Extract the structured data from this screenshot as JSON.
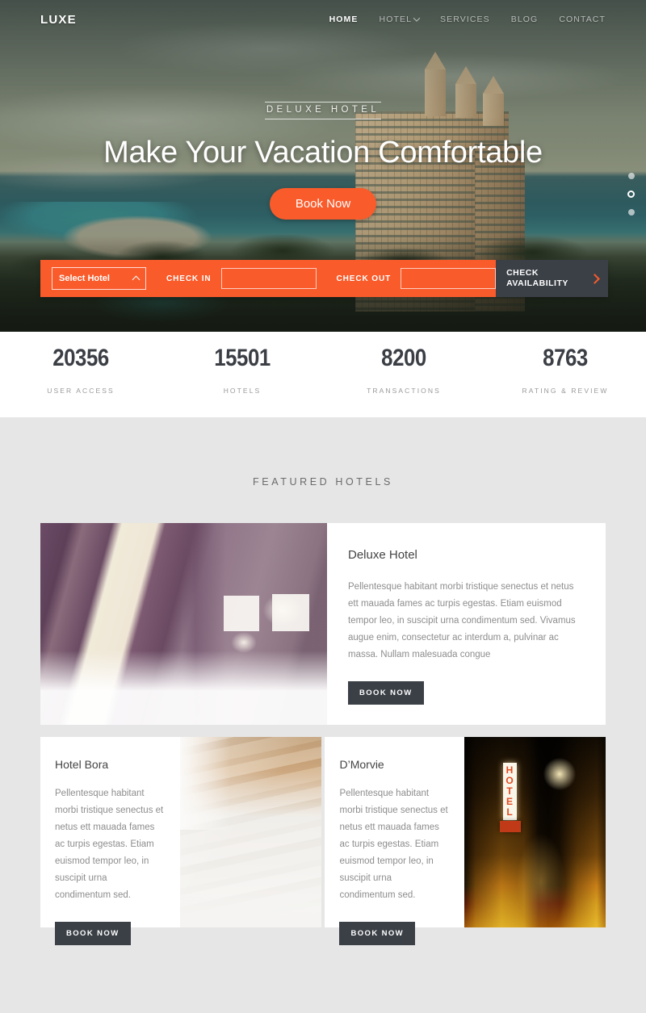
{
  "nav": {
    "brand": "LUXE",
    "links": [
      {
        "label": "HOME",
        "active": true
      },
      {
        "label": "HOTEL",
        "active": false,
        "has_caret": true
      },
      {
        "label": "SERVICES",
        "active": false
      },
      {
        "label": "BLOG",
        "active": false
      },
      {
        "label": "CONTACT",
        "active": false
      }
    ]
  },
  "hero": {
    "eyebrow": "DELUXE HOTEL",
    "title": "Make Your Vacation Comfortable",
    "cta_label": "Book Now",
    "accent_color": "#f95b2b",
    "slider": {
      "total": 3,
      "active_index": 1
    }
  },
  "booking": {
    "select_value": "Select Hotel",
    "checkin_label": "CHECK IN",
    "checkin_value": "",
    "checkin_placeholder": "",
    "checkout_label": "CHECK OUT",
    "checkout_value": "",
    "checkout_placeholder": "",
    "submit_line1": "CHECK",
    "submit_line2": "AVAILABILITY",
    "bar_color": "#f95b2b",
    "submit_color": "#3b4047"
  },
  "stats": [
    {
      "value": "20356",
      "label": "USER ACCESS"
    },
    {
      "value": "15501",
      "label": "HOTELS"
    },
    {
      "value": "8200",
      "label": "TRANSACTIONS"
    },
    {
      "value": "8763",
      "label": "RATING & REVIEW"
    }
  ],
  "featured": {
    "heading": "FEATURED HOTELS",
    "cards": [
      {
        "title": "Deluxe Hotel",
        "text": "Pellentesque habitant morbi tristique senectus et netus ett mauada fames ac turpis egestas. Etiam euismod tempor leo, in suscipit urna condimentum sed. Vivamus augue enim, consectetur ac interdum a, pulvinar ac massa. Nullam malesuada congue",
        "button": "BOOK NOW",
        "image": "hotel-bedroom-photo"
      },
      {
        "title": "Hotel Bora",
        "text": "Pellentesque habitant morbi tristique senectus et netus ett mauada fames ac turpis egestas. Etiam euismod tempor leo, in suscipit urna condimentum sed.",
        "button": "BOOK NOW",
        "image": "bed-pillows-photo"
      },
      {
        "title": "D’Morvie",
        "text": "Pellentesque habitant morbi tristique senectus et netus ett mauada fames ac turpis egestas. Etiam euismod tempor leo, in suscipit urna condimentum sed.",
        "button": "BOOK NOW",
        "image": "night-street-hotel-photo"
      }
    ]
  }
}
